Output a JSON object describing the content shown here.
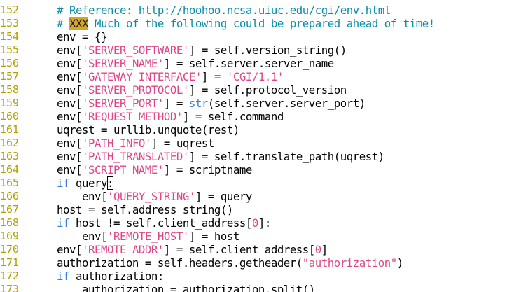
{
  "editor": {
    "colors": {
      "background": "#ffffff",
      "line_number": "#b0a000",
      "comment": "#0a8da8",
      "string": "#e0458a",
      "keyword": "#3b7fd6",
      "todo_highlight": "#d3a72b"
    },
    "lines": [
      {
        "num": "152",
        "tokens": [
          {
            "t": "comment",
            "v": "        # Reference: http://hoohoo.ncsa.uiuc.edu/cgi/env.html"
          }
        ]
      },
      {
        "num": "153",
        "tokens": [
          {
            "t": "comment",
            "v": "        # "
          },
          {
            "t": "todo",
            "v": "XXX"
          },
          {
            "t": "comment",
            "v": " Much of the following could be prepared ahead of time!"
          }
        ]
      },
      {
        "num": "154",
        "tokens": [
          {
            "t": "plain",
            "v": "        env = {}"
          }
        ]
      },
      {
        "num": "155",
        "tokens": [
          {
            "t": "plain",
            "v": "        env["
          },
          {
            "t": "string",
            "v": "'SERVER_SOFTWARE'"
          },
          {
            "t": "plain",
            "v": "] = self.version_string()"
          }
        ]
      },
      {
        "num": "156",
        "tokens": [
          {
            "t": "plain",
            "v": "        env["
          },
          {
            "t": "string",
            "v": "'SERVER_NAME'"
          },
          {
            "t": "plain",
            "v": "] = self.server.server_name"
          }
        ]
      },
      {
        "num": "157",
        "tokens": [
          {
            "t": "plain",
            "v": "        env["
          },
          {
            "t": "string",
            "v": "'GATEWAY_INTERFACE'"
          },
          {
            "t": "plain",
            "v": "] = "
          },
          {
            "t": "string",
            "v": "'CGI/1.1'"
          }
        ]
      },
      {
        "num": "158",
        "tokens": [
          {
            "t": "plain",
            "v": "        env["
          },
          {
            "t": "string",
            "v": "'SERVER_PROTOCOL'"
          },
          {
            "t": "plain",
            "v": "] = self.protocol_version"
          }
        ]
      },
      {
        "num": "159",
        "tokens": [
          {
            "t": "plain",
            "v": "        env["
          },
          {
            "t": "string",
            "v": "'SERVER_PORT'"
          },
          {
            "t": "plain",
            "v": "] = "
          },
          {
            "t": "builtin",
            "v": "str"
          },
          {
            "t": "plain",
            "v": "(self.server.server_port)"
          }
        ]
      },
      {
        "num": "160",
        "tokens": [
          {
            "t": "plain",
            "v": "        env["
          },
          {
            "t": "string",
            "v": "'REQUEST_METHOD'"
          },
          {
            "t": "plain",
            "v": "] = self.command"
          }
        ]
      },
      {
        "num": "161",
        "tokens": [
          {
            "t": "plain",
            "v": "        uqrest = urllib.unquote(rest)"
          }
        ]
      },
      {
        "num": "162",
        "tokens": [
          {
            "t": "plain",
            "v": "        env["
          },
          {
            "t": "string",
            "v": "'PATH_INFO'"
          },
          {
            "t": "plain",
            "v": "] = uqrest"
          }
        ]
      },
      {
        "num": "163",
        "tokens": [
          {
            "t": "plain",
            "v": "        env["
          },
          {
            "t": "string",
            "v": "'PATH_TRANSLATED'"
          },
          {
            "t": "plain",
            "v": "] = self.translate_path(uqrest)"
          }
        ]
      },
      {
        "num": "164",
        "tokens": [
          {
            "t": "plain",
            "v": "        env["
          },
          {
            "t": "string",
            "v": "'SCRIPT_NAME'"
          },
          {
            "t": "plain",
            "v": "] = scriptname"
          }
        ]
      },
      {
        "num": "165",
        "tokens": [
          {
            "t": "plain",
            "v": "        "
          },
          {
            "t": "keyword",
            "v": "if"
          },
          {
            "t": "plain",
            "v": " query"
          },
          {
            "t": "cursor",
            "v": ":"
          }
        ]
      },
      {
        "num": "166",
        "tokens": [
          {
            "t": "plain",
            "v": "            env["
          },
          {
            "t": "string",
            "v": "'QUERY_STRING'"
          },
          {
            "t": "plain",
            "v": "] = query"
          }
        ]
      },
      {
        "num": "167",
        "tokens": [
          {
            "t": "plain",
            "v": "        host = self.address_string()"
          }
        ]
      },
      {
        "num": "168",
        "tokens": [
          {
            "t": "plain",
            "v": "        "
          },
          {
            "t": "keyword",
            "v": "if"
          },
          {
            "t": "plain",
            "v": " host != self.client_address["
          },
          {
            "t": "number",
            "v": "0"
          },
          {
            "t": "plain",
            "v": "]:"
          }
        ]
      },
      {
        "num": "169",
        "tokens": [
          {
            "t": "plain",
            "v": "            env["
          },
          {
            "t": "string",
            "v": "'REMOTE_HOST'"
          },
          {
            "t": "plain",
            "v": "] = host"
          }
        ]
      },
      {
        "num": "170",
        "tokens": [
          {
            "t": "plain",
            "v": "        env["
          },
          {
            "t": "string",
            "v": "'REMOTE_ADDR'"
          },
          {
            "t": "plain",
            "v": "] = self.client_address["
          },
          {
            "t": "number",
            "v": "0"
          },
          {
            "t": "plain",
            "v": "]"
          }
        ]
      },
      {
        "num": "171",
        "tokens": [
          {
            "t": "plain",
            "v": "        authorization = self.headers.getheader("
          },
          {
            "t": "string",
            "v": "\"authorization\""
          },
          {
            "t": "plain",
            "v": ")"
          }
        ]
      },
      {
        "num": "172",
        "tokens": [
          {
            "t": "plain",
            "v": "        "
          },
          {
            "t": "keyword",
            "v": "if"
          },
          {
            "t": "plain",
            "v": " authorization:"
          }
        ]
      },
      {
        "num": "173",
        "tokens": [
          {
            "t": "plain",
            "v": "            authorization = authorization.split()"
          }
        ]
      }
    ]
  }
}
